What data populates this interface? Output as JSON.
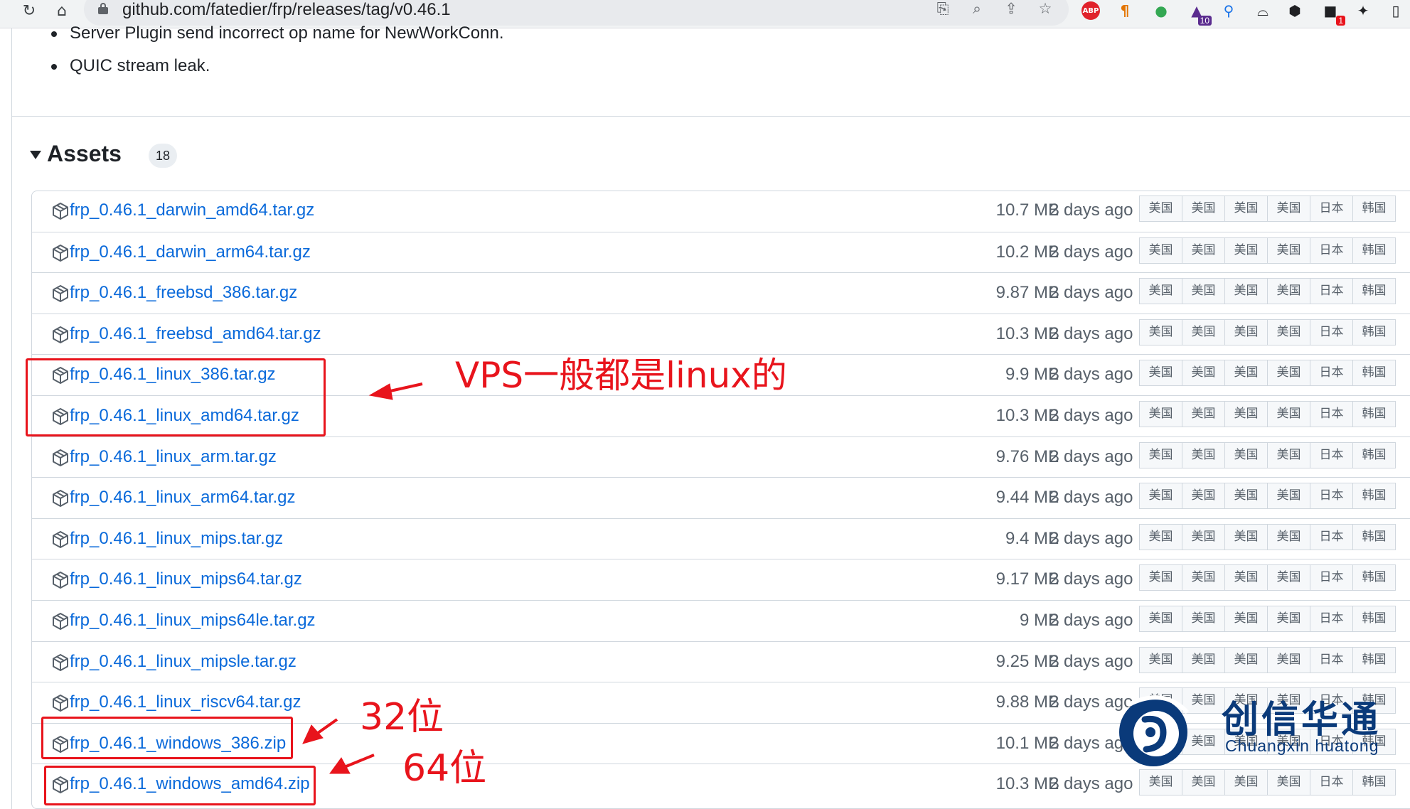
{
  "browser": {
    "url": "github.com/fatedier/frp/releases/tag/v0.46.1",
    "extensions": [
      {
        "icon": "translate-icon"
      },
      {
        "icon": "zoom-icon"
      },
      {
        "icon": "share-icon"
      },
      {
        "icon": "star-icon"
      },
      {
        "icon": "adblock-plus-icon",
        "label": "ABP"
      },
      {
        "icon": "pilcrow-icon",
        "label": "¶"
      },
      {
        "icon": "extension-green-icon"
      },
      {
        "icon": "graduation-cap-icon",
        "badge": "10"
      },
      {
        "icon": "pin-icon"
      },
      {
        "icon": "hat-icon"
      },
      {
        "icon": "shield-icon"
      },
      {
        "icon": "notification-icon",
        "badge": "1"
      },
      {
        "icon": "puzzle-icon"
      },
      {
        "icon": "window-icon"
      }
    ]
  },
  "release_notes": {
    "bullets": [
      "Server Plugin send incorrect op name for NewWorkConn.",
      "QUIC stream leak."
    ]
  },
  "assets": {
    "title": "Assets",
    "count": "18",
    "mirror_labels": [
      "美国",
      "美国",
      "美国",
      "美国",
      "日本",
      "韩国"
    ],
    "rows": [
      {
        "name": "frp_0.46.1_darwin_amd64.tar.gz",
        "size": "10.7 MB",
        "date": "2 days ago"
      },
      {
        "name": "frp_0.46.1_darwin_arm64.tar.gz",
        "size": "10.2 MB",
        "date": "2 days ago"
      },
      {
        "name": "frp_0.46.1_freebsd_386.tar.gz",
        "size": "9.87 MB",
        "date": "2 days ago"
      },
      {
        "name": "frp_0.46.1_freebsd_amd64.tar.gz",
        "size": "10.3 MB",
        "date": "2 days ago"
      },
      {
        "name": "frp_0.46.1_linux_386.tar.gz",
        "size": "9.9 MB",
        "date": "2 days ago"
      },
      {
        "name": "frp_0.46.1_linux_amd64.tar.gz",
        "size": "10.3 MB",
        "date": "2 days ago"
      },
      {
        "name": "frp_0.46.1_linux_arm.tar.gz",
        "size": "9.76 MB",
        "date": "2 days ago"
      },
      {
        "name": "frp_0.46.1_linux_arm64.tar.gz",
        "size": "9.44 MB",
        "date": "2 days ago"
      },
      {
        "name": "frp_0.46.1_linux_mips.tar.gz",
        "size": "9.4 MB",
        "date": "2 days ago"
      },
      {
        "name": "frp_0.46.1_linux_mips64.tar.gz",
        "size": "9.17 MB",
        "date": "2 days ago"
      },
      {
        "name": "frp_0.46.1_linux_mips64le.tar.gz",
        "size": "9 MB",
        "date": "2 days ago"
      },
      {
        "name": "frp_0.46.1_linux_mipsle.tar.gz",
        "size": "9.25 MB",
        "date": "2 days ago"
      },
      {
        "name": "frp_0.46.1_linux_riscv64.tar.gz",
        "size": "9.88 MB",
        "date": "2 days ago"
      },
      {
        "name": "frp_0.46.1_windows_386.zip",
        "size": "10.1 MB",
        "date": "2 days ago"
      },
      {
        "name": "frp_0.46.1_windows_amd64.zip",
        "size": "10.3 MB",
        "date": "2 days ago"
      }
    ]
  },
  "annotations": {
    "linux_note": "VPS一般都是linux的",
    "bit32": "32位",
    "bit64": "64位",
    "color": "#e8141c"
  },
  "watermark": {
    "name_cn": "创信华通",
    "name_en": "Chuangxin huatong"
  }
}
